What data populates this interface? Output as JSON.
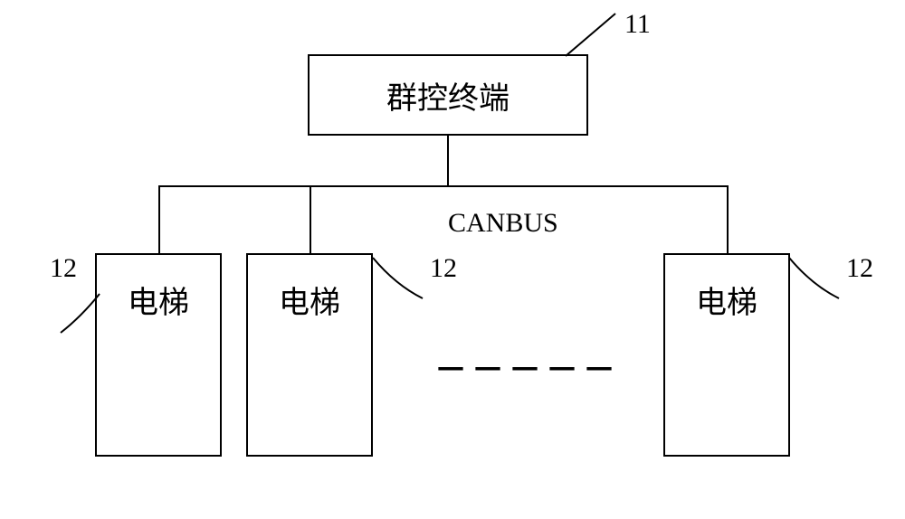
{
  "controller": {
    "label": "群控终端",
    "ref": "11"
  },
  "bus": {
    "label": "CANBUS"
  },
  "elevators": [
    {
      "label": "电梯",
      "ref": "12"
    },
    {
      "label": "电梯",
      "ref": "12"
    },
    {
      "label": "电梯",
      "ref": "12"
    }
  ],
  "ellipsis": "－－－－－"
}
